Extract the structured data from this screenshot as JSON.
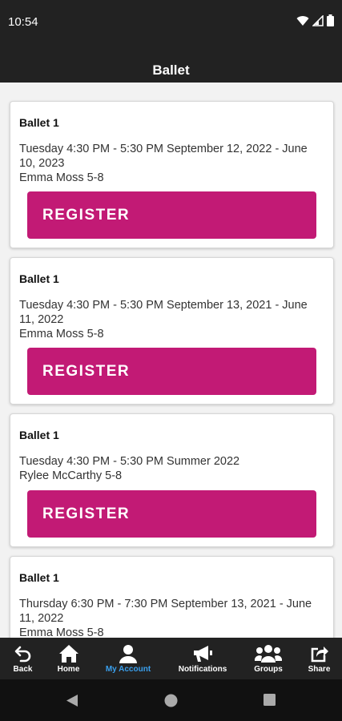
{
  "status": {
    "time": "10:54"
  },
  "header": {
    "title": "Ballet"
  },
  "cards": [
    {
      "title": "Ballet 1",
      "schedule": "Tuesday 4:30 PM - 5:30 PM September 12, 2022 - June 10, 2023",
      "instructor": "Emma Moss 5-8",
      "button": "REGISTER"
    },
    {
      "title": "Ballet 1",
      "schedule": "Tuesday 4:30 PM - 5:30 PM September 13, 2021 - June 11, 2022",
      "instructor": "Emma Moss 5-8",
      "button": "REGISTER"
    },
    {
      "title": "Ballet 1",
      "schedule": "Tuesday 4:30 PM - 5:30 PM Summer 2022",
      "instructor": "Rylee McCarthy 5-8",
      "button": "REGISTER"
    },
    {
      "title": "Ballet 1",
      "schedule": "Thursday 6:30 PM - 7:30 PM September 13, 2021 - June 11, 2022",
      "instructor": "Emma Moss 5-8"
    }
  ],
  "nav": {
    "back": "Back",
    "home": "Home",
    "account": "My Account",
    "notifications": "Notifications",
    "groups": "Groups",
    "share": "Share"
  },
  "colors": {
    "accent": "#c21a75",
    "active_nav": "#3aa0ee",
    "bar": "#222222"
  }
}
